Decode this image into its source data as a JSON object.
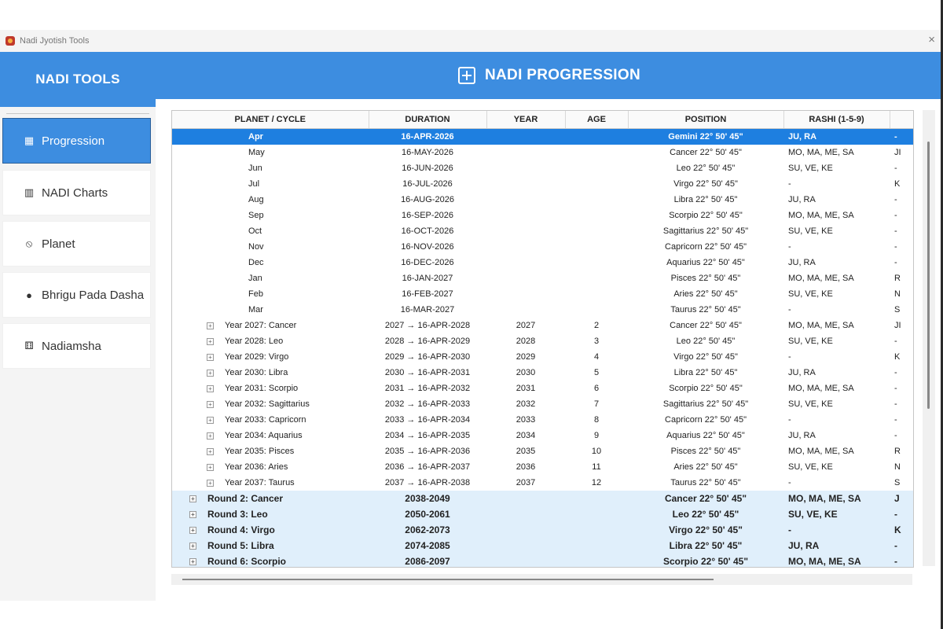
{
  "window": {
    "title": "Nadi Jyotish Tools",
    "close_glyph": "×"
  },
  "sidebar": {
    "title": "NADI TOOLS",
    "items": [
      {
        "label": "Progression",
        "icon": "grid-icon",
        "glyph": "▦",
        "active": true
      },
      {
        "label": "NADI Charts",
        "icon": "bar-chart-icon",
        "glyph": "▥",
        "active": false
      },
      {
        "label": "Planet",
        "icon": "planet-icon",
        "glyph": "⦸",
        "active": false
      },
      {
        "label": "Bhrigu Pada Dasha",
        "icon": "head-icon",
        "glyph": "●",
        "active": false
      },
      {
        "label": "Nadiamsha",
        "icon": "dice-icon",
        "glyph": "⚅",
        "active": false
      }
    ]
  },
  "header": {
    "title": "NADI PROGRESSION"
  },
  "table": {
    "columns": [
      "PLANET / CYCLE",
      "DURATION",
      "YEAR",
      "AGE",
      "POSITION",
      "RASHI (1-5-9)",
      ""
    ],
    "months": [
      {
        "c": "Apr",
        "d": "16-APR-2026",
        "p": "Gemini 22° 50' 45\"",
        "r": "JU, RA",
        "x": "-"
      },
      {
        "c": "May",
        "d": "16-MAY-2026",
        "p": "Cancer 22° 50' 45\"",
        "r": "MO, MA, ME, SA",
        "x": "JI"
      },
      {
        "c": "Jun",
        "d": "16-JUN-2026",
        "p": "Leo 22° 50' 45\"",
        "r": "SU, VE, KE",
        "x": "-"
      },
      {
        "c": "Jul",
        "d": "16-JUL-2026",
        "p": "Virgo 22° 50' 45\"",
        "r": "-",
        "x": "K"
      },
      {
        "c": "Aug",
        "d": "16-AUG-2026",
        "p": "Libra 22° 50' 45\"",
        "r": "JU, RA",
        "x": "-"
      },
      {
        "c": "Sep",
        "d": "16-SEP-2026",
        "p": "Scorpio 22° 50' 45\"",
        "r": "MO, MA, ME, SA",
        "x": "-"
      },
      {
        "c": "Oct",
        "d": "16-OCT-2026",
        "p": "Sagittarius 22° 50' 45\"",
        "r": "SU, VE, KE",
        "x": "-"
      },
      {
        "c": "Nov",
        "d": "16-NOV-2026",
        "p": "Capricorn 22° 50' 45\"",
        "r": "-",
        "x": "-"
      },
      {
        "c": "Dec",
        "d": "16-DEC-2026",
        "p": "Aquarius 22° 50' 45\"",
        "r": "JU, RA",
        "x": "-"
      },
      {
        "c": "Jan",
        "d": "16-JAN-2027",
        "p": "Pisces 22° 50' 45\"",
        "r": "MO, MA, ME, SA",
        "x": "R"
      },
      {
        "c": "Feb",
        "d": "16-FEB-2027",
        "p": "Aries 22° 50' 45\"",
        "r": "SU, VE, KE",
        "x": "N"
      },
      {
        "c": "Mar",
        "d": "16-MAR-2027",
        "p": "Taurus 22° 50' 45\"",
        "r": "-",
        "x": "S"
      }
    ],
    "years": [
      {
        "c": "Year 2027: Cancer",
        "d": "2027 → 16-APR-2028",
        "y": "2027",
        "a": "2",
        "p": "Cancer 22° 50' 45\"",
        "r": "MO, MA, ME, SA",
        "x": "JI"
      },
      {
        "c": "Year 2028: Leo",
        "d": "2028 → 16-APR-2029",
        "y": "2028",
        "a": "3",
        "p": "Leo 22° 50' 45\"",
        "r": "SU, VE, KE",
        "x": "-"
      },
      {
        "c": "Year 2029: Virgo",
        "d": "2029 → 16-APR-2030",
        "y": "2029",
        "a": "4",
        "p": "Virgo 22° 50' 45\"",
        "r": "-",
        "x": "K"
      },
      {
        "c": "Year 2030: Libra",
        "d": "2030 → 16-APR-2031",
        "y": "2030",
        "a": "5",
        "p": "Libra 22° 50' 45\"",
        "r": "JU, RA",
        "x": "-"
      },
      {
        "c": "Year 2031: Scorpio",
        "d": "2031 → 16-APR-2032",
        "y": "2031",
        "a": "6",
        "p": "Scorpio 22° 50' 45\"",
        "r": "MO, MA, ME, SA",
        "x": "-"
      },
      {
        "c": "Year 2032: Sagittarius",
        "d": "2032 → 16-APR-2033",
        "y": "2032",
        "a": "7",
        "p": "Sagittarius 22° 50' 45\"",
        "r": "SU, VE, KE",
        "x": "-"
      },
      {
        "c": "Year 2033: Capricorn",
        "d": "2033 → 16-APR-2034",
        "y": "2033",
        "a": "8",
        "p": "Capricorn 22° 50' 45\"",
        "r": "-",
        "x": "-"
      },
      {
        "c": "Year 2034: Aquarius",
        "d": "2034 → 16-APR-2035",
        "y": "2034",
        "a": "9",
        "p": "Aquarius 22° 50' 45\"",
        "r": "JU, RA",
        "x": "-"
      },
      {
        "c": "Year 2035: Pisces",
        "d": "2035 → 16-APR-2036",
        "y": "2035",
        "a": "10",
        "p": "Pisces 22° 50' 45\"",
        "r": "MO, MA, ME, SA",
        "x": "R"
      },
      {
        "c": "Year 2036: Aries",
        "d": "2036 → 16-APR-2037",
        "y": "2036",
        "a": "11",
        "p": "Aries 22° 50' 45\"",
        "r": "SU, VE, KE",
        "x": "N"
      },
      {
        "c": "Year 2037: Taurus",
        "d": "2037 → 16-APR-2038",
        "y": "2037",
        "a": "12",
        "p": "Taurus 22° 50' 45\"",
        "r": "-",
        "x": "S"
      }
    ],
    "rounds": [
      {
        "c": "Round 2: Cancer",
        "d": "2038-2049",
        "p": "Cancer 22° 50' 45\"",
        "r": "MO, MA, ME, SA",
        "x": "J"
      },
      {
        "c": "Round 3: Leo",
        "d": "2050-2061",
        "p": "Leo 22° 50' 45\"",
        "r": "SU, VE, KE",
        "x": "-"
      },
      {
        "c": "Round 4: Virgo",
        "d": "2062-2073",
        "p": "Virgo 22° 50' 45\"",
        "r": "-",
        "x": "K"
      },
      {
        "c": "Round 5: Libra",
        "d": "2074-2085",
        "p": "Libra 22° 50' 45\"",
        "r": "JU, RA",
        "x": "-"
      },
      {
        "c": "Round 6: Scorpio",
        "d": "2086-2097",
        "p": "Scorpio 22° 50' 45\"",
        "r": "MO, MA, ME, SA",
        "x": "-"
      }
    ]
  },
  "colors": {
    "accent": "#3d8de0",
    "selected_row": "#1e7fe0",
    "round_row": "#e0effb"
  }
}
